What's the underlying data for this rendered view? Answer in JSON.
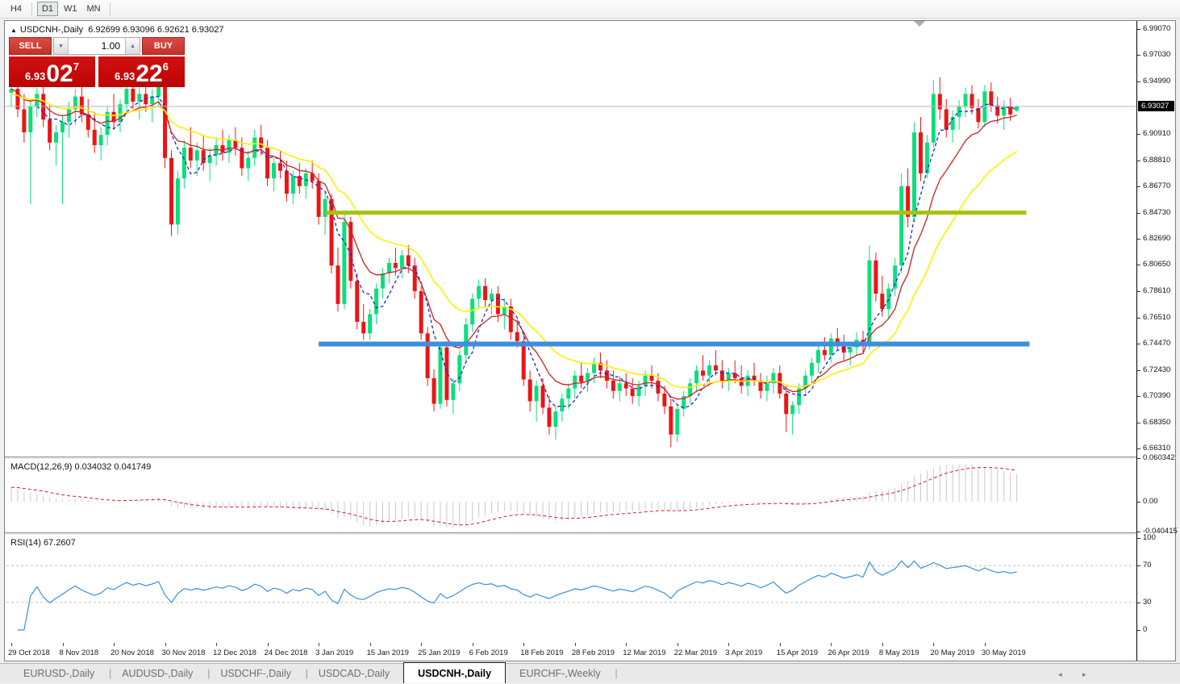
{
  "toolbar": {
    "timeframes": [
      {
        "label": "H4",
        "active": false
      },
      {
        "label": "D1",
        "active": true
      },
      {
        "label": "W1",
        "active": false
      },
      {
        "label": "MN",
        "active": false
      }
    ]
  },
  "header": {
    "collapse_icon": "▲",
    "title": "USDCNH-,Daily",
    "ohlc_text": "6.92699 6.93096 6.92621 6.93027"
  },
  "trade_panel": {
    "sell_label": "SELL",
    "buy_label": "BUY",
    "volume": "1.00",
    "spinner_down": "▼",
    "spinner_up": "▲",
    "sell_price": {
      "prefix": "6.93",
      "big": "02",
      "sup": "7"
    },
    "buy_price": {
      "prefix": "6.93",
      "big": "22",
      "sup": "6"
    }
  },
  "price_axis": {
    "labels": [
      "6.99070",
      "6.97030",
      "6.94990",
      "6.90910",
      "6.88810",
      "6.86770",
      "6.84730",
      "6.82690",
      "6.80650",
      "6.78610",
      "6.76510",
      "6.74470",
      "6.72430",
      "6.70390",
      "6.68350",
      "6.66310"
    ],
    "current": "6.93027"
  },
  "x_axis": {
    "labels": [
      "29 Oct 2018",
      "8 Nov 2018",
      "20 Nov 2018",
      "30 Nov 2018",
      "12 Dec 2018",
      "24 Dec 2018",
      "3 Jan 2019",
      "15 Jan 2019",
      "25 Jan 2019",
      "6 Feb 2019",
      "18 Feb 2019",
      "28 Feb 2019",
      "12 Mar 2019",
      "22 Mar 2019",
      "3 Apr 2019",
      "15 Apr 2019",
      "26 Apr 2019",
      "8 May 2019",
      "20 May 2019",
      "30 May 2019"
    ],
    "tick_every_bars": 8
  },
  "tabs": {
    "items": [
      {
        "label": "EURUSD-,Daily",
        "active": false
      },
      {
        "label": "AUDUSD-,Daily",
        "active": false
      },
      {
        "label": "USDCHF-,Daily",
        "active": false
      },
      {
        "label": "USDCAD-,Daily",
        "active": false
      },
      {
        "label": "USDCNH-,Daily",
        "active": true
      },
      {
        "label": "EURCHF-,Weekly",
        "active": false
      }
    ],
    "scroll_left": "◂",
    "scroll_right": "▸"
  },
  "colors": {
    "candle_up": "#0bdf7d",
    "candle_down": "#eb1515",
    "ma_fast": "#2126c8",
    "ma_mid": "#d02020",
    "ma_slow": "#fff000",
    "macd_hist": "#c9c9c9",
    "macd_signal": "#d02020",
    "rsi_line": "#3e8ede",
    "rsi_levels": "#c3c3c3",
    "hline_blue": "#3e8ede",
    "hline_olive": "#a6c20a",
    "current_line": "#b9b9b9"
  },
  "chart_data": {
    "type": "candlestick",
    "title": "USDCNH-,Daily",
    "ylim": [
      6.6631,
      6.9907
    ],
    "current_price": 6.93027,
    "ohlc": [
      [
        6.941,
        6.948,
        6.93,
        6.944
      ],
      [
        6.944,
        6.949,
        6.922,
        6.928
      ],
      [
        6.928,
        6.94,
        6.902,
        6.91
      ],
      [
        6.91,
        6.936,
        6.854,
        6.93
      ],
      [
        6.93,
        6.945,
        6.922,
        6.94
      ],
      [
        6.94,
        6.947,
        6.914,
        6.92
      ],
      [
        6.92,
        6.932,
        6.896,
        6.902
      ],
      [
        6.902,
        6.916,
        6.884,
        6.91
      ],
      [
        6.91,
        6.924,
        6.854,
        6.918
      ],
      [
        6.918,
        6.934,
        6.906,
        6.928
      ],
      [
        6.928,
        6.944,
        6.916,
        6.938
      ],
      [
        6.938,
        6.946,
        6.918,
        6.924
      ],
      [
        6.924,
        6.936,
        6.906,
        6.912
      ],
      [
        6.912,
        6.926,
        6.894,
        6.9
      ],
      [
        6.9,
        6.914,
        6.888,
        6.908
      ],
      [
        6.908,
        6.93,
        6.9,
        6.926
      ],
      [
        6.926,
        6.94,
        6.912,
        6.918
      ],
      [
        6.918,
        6.936,
        6.91,
        6.932
      ],
      [
        6.932,
        6.948,
        6.924,
        6.944
      ],
      [
        6.944,
        6.949,
        6.928,
        6.934
      ],
      [
        6.934,
        6.946,
        6.92,
        6.94
      ],
      [
        6.94,
        6.948,
        6.926,
        6.932
      ],
      [
        6.932,
        6.944,
        6.918,
        6.938
      ],
      [
        6.938,
        6.95,
        6.93,
        6.946
      ],
      [
        6.946,
        6.951,
        6.882,
        6.89
      ],
      [
        6.89,
        6.896,
        6.829,
        6.838
      ],
      [
        6.838,
        6.88,
        6.83,
        6.874
      ],
      [
        6.874,
        6.904,
        6.866,
        6.898
      ],
      [
        6.898,
        6.914,
        6.882,
        6.888
      ],
      [
        6.888,
        6.902,
        6.876,
        6.896
      ],
      [
        6.896,
        6.908,
        6.88,
        6.886
      ],
      [
        6.886,
        6.898,
        6.872,
        6.892
      ],
      [
        6.892,
        6.906,
        6.884,
        6.9
      ],
      [
        6.9,
        6.912,
        6.888,
        6.894
      ],
      [
        6.894,
        6.908,
        6.886,
        6.904
      ],
      [
        6.904,
        6.914,
        6.892,
        6.898
      ],
      [
        6.898,
        6.906,
        6.876,
        6.882
      ],
      [
        6.882,
        6.896,
        6.872,
        6.89
      ],
      [
        6.89,
        6.912,
        6.884,
        6.906
      ],
      [
        6.906,
        6.916,
        6.892,
        6.898
      ],
      [
        6.898,
        6.904,
        6.868,
        6.874
      ],
      [
        6.874,
        6.89,
        6.864,
        6.886
      ],
      [
        6.886,
        6.896,
        6.874,
        6.88
      ],
      [
        6.88,
        6.888,
        6.856,
        6.862
      ],
      [
        6.862,
        6.88,
        6.854,
        6.876
      ],
      [
        6.876,
        6.886,
        6.862,
        6.868
      ],
      [
        6.868,
        6.882,
        6.858,
        6.878
      ],
      [
        6.878,
        6.888,
        6.866,
        6.872
      ],
      [
        6.872,
        6.878,
        6.838,
        6.844
      ],
      [
        6.844,
        6.864,
        6.83,
        6.858
      ],
      [
        6.858,
        6.862,
        6.8,
        6.806
      ],
      [
        6.806,
        6.82,
        6.77,
        6.776
      ],
      [
        6.776,
        6.846,
        6.772,
        6.84
      ],
      [
        6.84,
        6.844,
        6.788,
        6.794
      ],
      [
        6.794,
        6.8,
        6.756,
        6.762
      ],
      [
        6.762,
        6.776,
        6.748,
        6.753
      ],
      [
        6.753,
        6.772,
        6.748,
        6.768
      ],
      [
        6.768,
        6.792,
        6.76,
        6.788
      ],
      [
        6.788,
        6.804,
        6.78,
        6.8
      ],
      [
        6.8,
        6.812,
        6.792,
        6.808
      ],
      [
        6.808,
        6.82,
        6.798,
        6.804
      ],
      [
        6.804,
        6.818,
        6.796,
        6.814
      ],
      [
        6.814,
        6.822,
        6.8,
        6.806
      ],
      [
        6.806,
        6.812,
        6.78,
        6.786
      ],
      [
        6.786,
        6.79,
        6.748,
        6.753
      ],
      [
        6.753,
        6.758,
        6.712,
        6.718
      ],
      [
        6.718,
        6.725,
        6.692,
        6.698
      ],
      [
        6.698,
        6.746,
        6.694,
        6.742
      ],
      [
        6.742,
        6.747,
        6.696,
        6.701
      ],
      [
        6.701,
        6.718,
        6.69,
        6.714
      ],
      [
        6.714,
        6.74,
        6.708,
        6.736
      ],
      [
        6.736,
        6.765,
        6.73,
        6.76
      ],
      [
        6.76,
        6.784,
        6.754,
        6.78
      ],
      [
        6.78,
        6.795,
        6.772,
        6.79
      ],
      [
        6.79,
        6.796,
        6.774,
        6.779
      ],
      [
        6.779,
        6.788,
        6.768,
        6.784
      ],
      [
        6.784,
        6.79,
        6.762,
        6.768
      ],
      [
        6.768,
        6.78,
        6.756,
        6.774
      ],
      [
        6.774,
        6.78,
        6.748,
        6.754
      ],
      [
        6.754,
        6.764,
        6.742,
        6.747
      ],
      [
        6.747,
        6.752,
        6.712,
        6.717
      ],
      [
        6.717,
        6.724,
        6.692,
        6.7
      ],
      [
        6.7,
        6.716,
        6.684,
        6.712
      ],
      [
        6.712,
        6.718,
        6.69,
        6.695
      ],
      [
        6.695,
        6.704,
        6.674,
        6.68
      ],
      [
        6.68,
        6.696,
        6.67,
        6.692
      ],
      [
        6.692,
        6.706,
        6.684,
        6.702
      ],
      [
        6.702,
        6.714,
        6.694,
        6.71
      ],
      [
        6.71,
        6.724,
        6.702,
        6.72
      ],
      [
        6.72,
        6.73,
        6.71,
        6.715
      ],
      [
        6.715,
        6.726,
        6.707,
        6.722
      ],
      [
        6.722,
        6.734,
        6.714,
        6.73
      ],
      [
        6.73,
        6.738,
        6.718,
        6.724
      ],
      [
        6.724,
        6.732,
        6.71,
        6.716
      ],
      [
        6.716,
        6.724,
        6.702,
        6.708
      ],
      [
        6.708,
        6.72,
        6.7,
        6.714
      ],
      [
        6.714,
        6.722,
        6.704,
        6.71
      ],
      [
        6.71,
        6.718,
        6.698,
        6.704
      ],
      [
        6.704,
        6.716,
        6.696,
        6.712
      ],
      [
        6.712,
        6.724,
        6.704,
        6.72
      ],
      [
        6.72,
        6.728,
        6.71,
        6.716
      ],
      [
        6.716,
        6.722,
        6.7,
        6.706
      ],
      [
        6.706,
        6.712,
        6.69,
        6.696
      ],
      [
        6.696,
        6.702,
        6.664,
        6.674
      ],
      [
        6.674,
        6.698,
        6.668,
        6.694
      ],
      [
        6.694,
        6.708,
        6.688,
        6.704
      ],
      [
        6.704,
        6.718,
        6.698,
        6.714
      ],
      [
        6.714,
        6.728,
        6.708,
        6.724
      ],
      [
        6.724,
        6.736,
        6.716,
        6.72
      ],
      [
        6.72,
        6.732,
        6.712,
        6.728
      ],
      [
        6.728,
        6.74,
        6.72,
        6.724
      ],
      [
        6.724,
        6.732,
        6.71,
        6.716
      ],
      [
        6.716,
        6.726,
        6.708,
        6.722
      ],
      [
        6.722,
        6.732,
        6.714,
        6.718
      ],
      [
        6.718,
        6.728,
        6.706,
        6.712
      ],
      [
        6.712,
        6.724,
        6.704,
        6.72
      ],
      [
        6.72,
        6.73,
        6.712,
        6.716
      ],
      [
        6.716,
        6.722,
        6.702,
        6.708
      ],
      [
        6.708,
        6.72,
        6.7,
        6.714
      ],
      [
        6.714,
        6.726,
        6.706,
        6.722
      ],
      [
        6.722,
        6.728,
        6.702,
        6.706
      ],
      [
        6.706,
        6.712,
        6.676,
        6.69
      ],
      [
        6.69,
        6.7,
        6.674,
        6.697
      ],
      [
        6.697,
        6.714,
        6.69,
        6.71
      ],
      [
        6.71,
        6.724,
        6.704,
        6.72
      ],
      [
        6.72,
        6.734,
        6.714,
        6.73
      ],
      [
        6.73,
        6.744,
        6.722,
        6.74
      ],
      [
        6.74,
        6.75,
        6.732,
        6.736
      ],
      [
        6.736,
        6.753,
        6.73,
        6.749
      ],
      [
        6.749,
        6.757,
        6.74,
        6.744
      ],
      [
        6.744,
        6.752,
        6.732,
        6.738
      ],
      [
        6.738,
        6.746,
        6.728,
        6.742
      ],
      [
        6.742,
        6.754,
        6.736,
        6.748
      ],
      [
        6.748,
        6.755,
        6.738,
        6.743
      ],
      [
        6.744,
        6.822,
        6.74,
        6.81
      ],
      [
        6.81,
        6.816,
        6.778,
        6.784
      ],
      [
        6.784,
        6.798,
        6.766,
        6.772
      ],
      [
        6.772,
        6.792,
        6.764,
        6.788
      ],
      [
        6.788,
        6.812,
        6.782,
        6.806
      ],
      [
        6.806,
        6.878,
        6.8,
        6.868
      ],
      [
        6.868,
        6.882,
        6.836,
        6.844
      ],
      [
        6.844,
        6.918,
        6.84,
        6.91
      ],
      [
        6.91,
        6.922,
        6.872,
        6.878
      ],
      [
        6.878,
        6.908,
        6.874,
        6.902
      ],
      [
        6.902,
        6.951,
        6.898,
        6.94
      ],
      [
        6.94,
        6.953,
        6.92,
        6.928
      ],
      [
        6.928,
        6.936,
        6.906,
        6.912
      ],
      [
        6.912,
        6.927,
        6.902,
        6.922
      ],
      [
        6.922,
        6.935,
        6.912,
        6.93
      ],
      [
        6.93,
        6.945,
        6.922,
        6.94
      ],
      [
        6.94,
        6.947,
        6.924,
        6.929
      ],
      [
        6.929,
        6.936,
        6.913,
        6.918
      ],
      [
        6.918,
        6.947,
        6.914,
        6.942
      ],
      [
        6.942,
        6.949,
        6.926,
        6.931
      ],
      [
        6.931,
        6.938,
        6.917,
        6.923
      ],
      [
        6.923,
        6.935,
        6.912,
        6.93
      ],
      [
        6.93,
        6.937,
        6.919,
        6.924
      ],
      [
        6.92699,
        6.93096,
        6.92621,
        6.93027
      ]
    ],
    "moving_averages": [
      {
        "name": "fast",
        "type": "sma",
        "period": 5,
        "color": "#2126c8",
        "style": "dashed"
      },
      {
        "name": "mid",
        "type": "ema",
        "period": 10,
        "color": "#d02020",
        "style": "solid"
      },
      {
        "name": "slow",
        "type": "ema",
        "period": 21,
        "color": "#fff000",
        "style": "solid"
      }
    ],
    "hlines": [
      {
        "price": 6.8473,
        "color": "#a6c20a",
        "width": 5,
        "from_bar": 49,
        "to_bar": 158.5
      },
      {
        "price": 6.7447,
        "color": "#3e8ede",
        "width": 6,
        "from_bar": 48,
        "to_bar": 159
      }
    ],
    "macd": {
      "fast": 12,
      "slow": 26,
      "signal_period": 9,
      "label": "MACD(12,26,9) 0.034032 0.041749",
      "main_value": "0.034032",
      "signal_value": "0.041749",
      "scale_labels": [
        "0.060342",
        "0.00",
        "-0.040415"
      ]
    },
    "rsi": {
      "period": 14,
      "label": "RSI(14) 67.2607",
      "value": "67.2607",
      "levels": [
        70,
        30
      ],
      "scale_labels": [
        "100",
        "70",
        "30",
        "0"
      ]
    }
  }
}
